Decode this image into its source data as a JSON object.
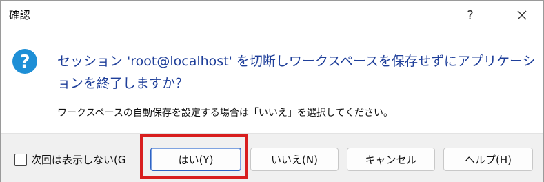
{
  "window": {
    "title": "確認",
    "help_glyph": "?",
    "close_icon": "close-icon"
  },
  "message": {
    "icon": "question-icon",
    "main": "セッション 'root@localhost' を切断しワークスペースを保存せずにアプリケーションを終了しますか？",
    "sub": "ワークスペースの自動保存を設定する場合は「いいえ」を選択してください。"
  },
  "footer": {
    "checkbox_label": "次回は表示しない(G",
    "checkbox_checked": false,
    "buttons": {
      "yes": "はい(Y)",
      "no": "いいえ(N)",
      "cancel": "キャンセル",
      "help": "ヘルプ(H)"
    }
  },
  "colors": {
    "accent": "#2f63c4",
    "message_text": "#1f3f9a",
    "icon": "#1e8fd6",
    "highlight": "#d81e1e"
  }
}
